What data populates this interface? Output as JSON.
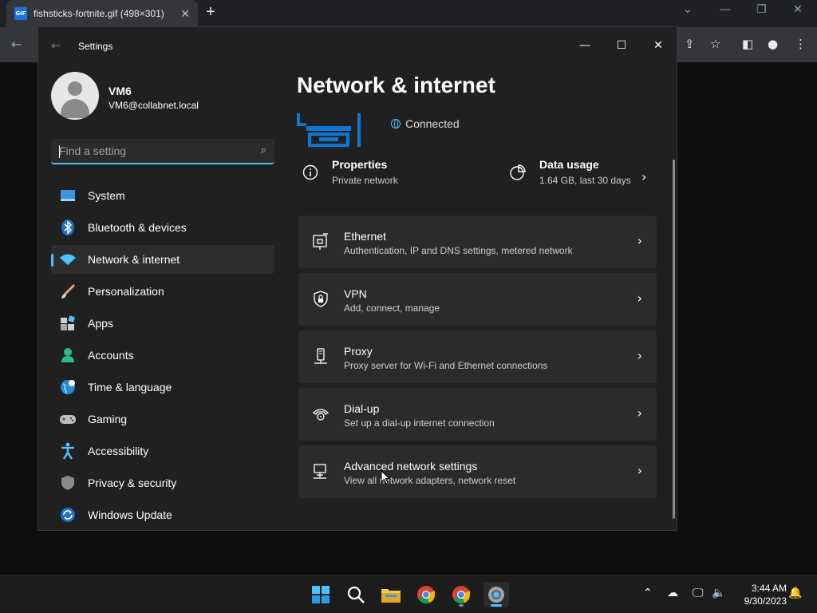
{
  "browser": {
    "tab_title": "fishsticks-fortnite.gif (498×301)",
    "tab_icon_text": "GIF",
    "new_tab": "+",
    "tab_close": "✕"
  },
  "settings": {
    "window_title": "Settings",
    "user": {
      "name": "VM6",
      "email": "VM6@collabnet.local"
    },
    "search": {
      "placeholder": "Find a setting"
    },
    "nav": [
      {
        "label": "System",
        "icon": "system-icon"
      },
      {
        "label": "Bluetooth & devices",
        "icon": "bluetooth-icon"
      },
      {
        "label": "Network & internet",
        "icon": "wifi-icon",
        "selected": true
      },
      {
        "label": "Personalization",
        "icon": "brush-icon"
      },
      {
        "label": "Apps",
        "icon": "apps-icon"
      },
      {
        "label": "Accounts",
        "icon": "person-icon"
      },
      {
        "label": "Time & language",
        "icon": "globe-clock-icon"
      },
      {
        "label": "Gaming",
        "icon": "gamepad-icon"
      },
      {
        "label": "Accessibility",
        "icon": "accessibility-icon"
      },
      {
        "label": "Privacy & security",
        "icon": "shield-icon"
      },
      {
        "label": "Windows Update",
        "icon": "update-icon"
      }
    ],
    "page_title": "Network & internet",
    "connection_status": "Connected",
    "properties": {
      "title": "Properties",
      "subtitle": "Private network"
    },
    "data_usage": {
      "title": "Data usage",
      "subtitle": "1.64 GB, last 30 days"
    },
    "cards": [
      {
        "title": "Ethernet",
        "subtitle": "Authentication, IP and DNS settings, metered network",
        "icon": "ethernet-icon"
      },
      {
        "title": "VPN",
        "subtitle": "Add, connect, manage",
        "icon": "vpn-shield-icon"
      },
      {
        "title": "Proxy",
        "subtitle": "Proxy server for Wi-Fi and Ethernet connections",
        "icon": "proxy-icon"
      },
      {
        "title": "Dial-up",
        "subtitle": "Set up a dial-up internet connection",
        "icon": "dialup-icon"
      },
      {
        "title": "Advanced network settings",
        "subtitle": "View all network adapters, network reset",
        "icon": "advanced-network-icon"
      }
    ]
  },
  "taskbar": {
    "time": "3:44 AM",
    "date": "9/30/2023"
  },
  "colors": {
    "accent": "#4cc2ff",
    "window_bg": "#202020",
    "card_bg": "#2b2b2b",
    "router_blue": "#0a78d4"
  }
}
